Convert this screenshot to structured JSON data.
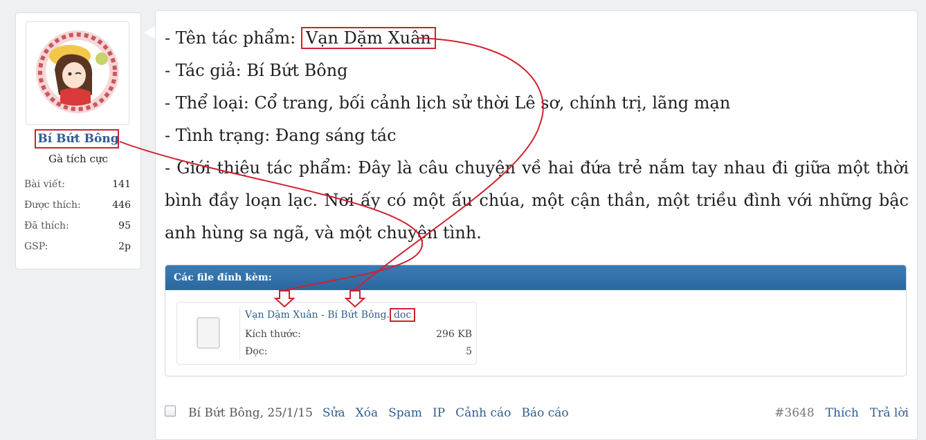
{
  "user": {
    "name": "Bí Bứt Bông",
    "title": "Gà tích cực",
    "stats": [
      {
        "label": "Bài viết:",
        "value": "141"
      },
      {
        "label": "Được thích:",
        "value": "446"
      },
      {
        "label": "Đã thích:",
        "value": "95"
      },
      {
        "label": "GSP:",
        "value": "2p"
      }
    ]
  },
  "post": {
    "line1_prefix": "- Tên tác phẩm: ",
    "line1_title": "Vạn Dặm Xuân",
    "line2": "- Tác giả: Bí Bứt Bông",
    "line3": "- Thể loại: Cổ trang, bối cảnh lịch sử thời Lê sơ, chính trị, lãng mạn",
    "line4": "- Tình trạng: Đang sáng tác",
    "line5": "- Giới thiệu tác phẩm: Đây là câu chuyện về hai đứa trẻ nắm tay nhau đi giữa một thời bình đầy loạn lạc. Nơi ấy có một ấu chúa, một cận thần, một triều đình với những bậc anh hùng sa ngã, và một chuyện tình."
  },
  "attachments": {
    "header": "Các file đính kèm:",
    "file": {
      "name": "Vạn Dặm Xuân - Bí Bứt Bông",
      "ext": "doc",
      "size_label": "Kích thước:",
      "size_value": "296 KB",
      "reads_label": "Đọc:",
      "reads_value": "5"
    }
  },
  "footer": {
    "author_date": "Bí Bứt Bông, 25/1/15",
    "links": [
      "Sửa",
      "Xóa",
      "Spam",
      "IP",
      "Cảnh cáo",
      "Báo cáo"
    ],
    "post_number": "#3648",
    "like": "Thích",
    "reply": "Trả lời"
  },
  "colors": {
    "annotation": "#d0202e",
    "link": "#2f5d8e",
    "attach_header": "#2c679f"
  }
}
